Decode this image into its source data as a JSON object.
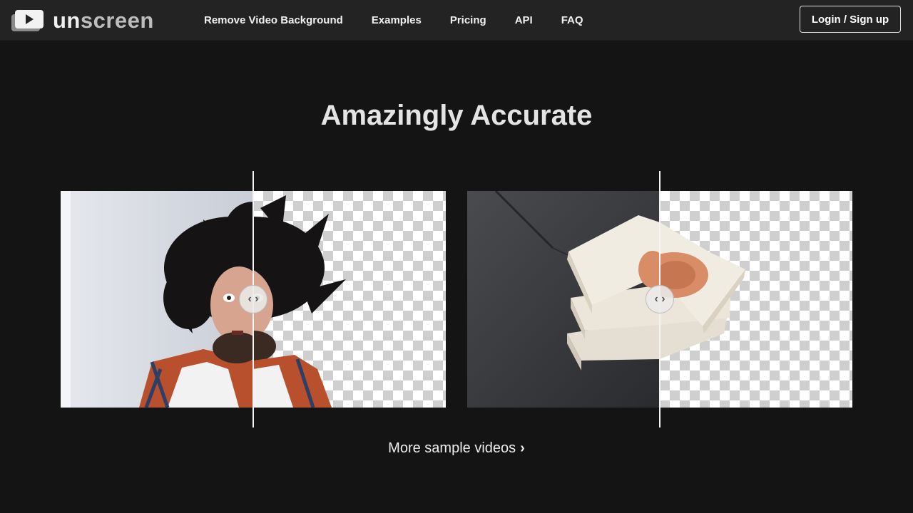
{
  "brand": {
    "name_part1": "un",
    "name_part2": "screen"
  },
  "nav": {
    "items": [
      {
        "label": "Remove Video Background"
      },
      {
        "label": "Examples"
      },
      {
        "label": "Pricing"
      },
      {
        "label": "API"
      },
      {
        "label": "FAQ"
      }
    ]
  },
  "header": {
    "login_label": "Login / Sign up"
  },
  "main": {
    "headline": "Amazingly Accurate",
    "more_link": "More sample videos",
    "comparisons": [
      {
        "subject": "man with wild hair",
        "split_percent": 50
      },
      {
        "subject": "stack of books",
        "split_percent": 50
      }
    ]
  },
  "colors": {
    "background": "#141414",
    "topbar": "#232323",
    "text": "#e8e8e8"
  }
}
